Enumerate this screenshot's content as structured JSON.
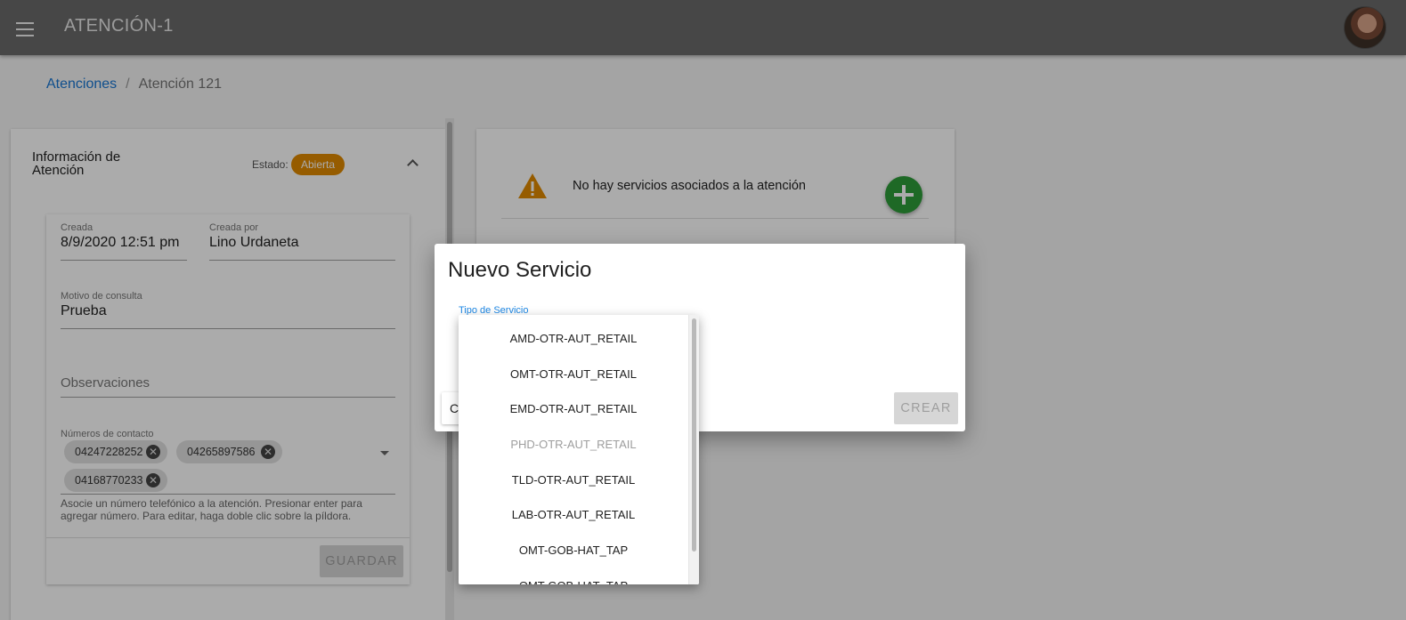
{
  "appbar": {
    "title": "ATENCIÓN-1"
  },
  "breadcrumb": {
    "link": "Atenciones",
    "separator": "/",
    "current": "Atención 121"
  },
  "info_panel": {
    "title": "Información de Atención",
    "estado_label": "Estado:",
    "estado_value": "Abierta",
    "estado_color": "#e08a00",
    "fields": {
      "creada_label": "Creada",
      "creada_value": "8/9/2020 12:51 pm",
      "creada_por_label": "Creada por",
      "creada_por_value": "Lino Urdaneta",
      "motivo_label": "Motivo de consulta",
      "motivo_value": "Prueba",
      "observaciones_placeholder": "Observaciones",
      "numeros_label": "Números de contacto",
      "numeros": [
        "04247228252",
        "04265897586",
        "04168770233"
      ],
      "numeros_hint": "Asocie un número telefónico a la atención. Presionar enter para agregar número. Para editar, haga doble clic sobre la píldora."
    },
    "save_label": "GUARDAR"
  },
  "services_panel": {
    "empty_message": "No hay servicios asociados a la atención",
    "warning_color": "#e08a00",
    "fab_color": "#2e9d3a"
  },
  "dialog": {
    "title": "Nuevo Servicio",
    "select_label": "Tipo de Servicio",
    "cancel_label": "C",
    "create_label": "CREAR",
    "options": [
      {
        "label": "AMD-OTR-AUT_RETAIL",
        "disabled": false
      },
      {
        "label": "OMT-OTR-AUT_RETAIL",
        "disabled": false
      },
      {
        "label": "EMD-OTR-AUT_RETAIL",
        "disabled": false
      },
      {
        "label": "PHD-OTR-AUT_RETAIL",
        "disabled": true
      },
      {
        "label": "TLD-OTR-AUT_RETAIL",
        "disabled": false
      },
      {
        "label": "LAB-OTR-AUT_RETAIL",
        "disabled": false
      },
      {
        "label": "OMT-GOB-HAT_TAP",
        "disabled": false
      },
      {
        "label": "OMT-GOB-HAT_TAP",
        "disabled": false
      }
    ]
  }
}
